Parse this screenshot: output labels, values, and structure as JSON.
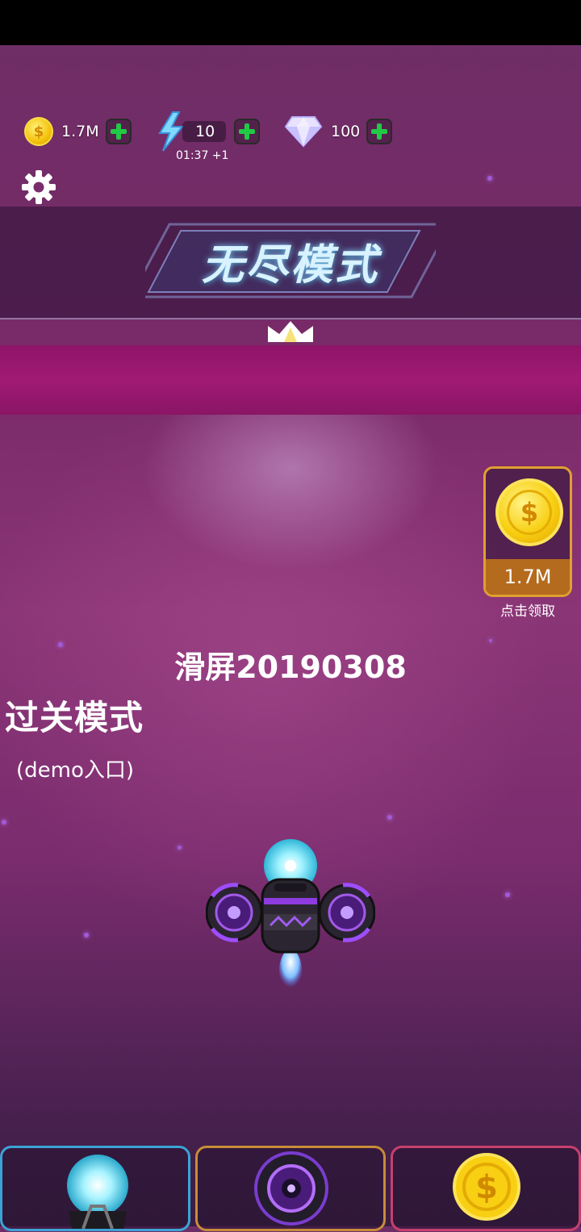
{
  "resources": {
    "coins": {
      "value": "1.7M",
      "icon": "coin-icon"
    },
    "energy": {
      "value": "10",
      "timer": "01:37 +1",
      "icon": "lightning-icon"
    },
    "gems": {
      "value": "100",
      "icon": "diamond-icon"
    }
  },
  "banner": {
    "title": "无尽模式"
  },
  "reward": {
    "amount": "1.7M",
    "label": "点击领取"
  },
  "main": {
    "swipe_label": "滑屏20190308",
    "level_mode": "过关模式",
    "demo_entry": "(demo入口)"
  },
  "tabs": [
    {
      "name": "orb-weapon",
      "icon": "orb-icon"
    },
    {
      "name": "vortex-wing",
      "icon": "vortex-icon"
    },
    {
      "name": "coin-shop",
      "icon": "coin-icon"
    }
  ],
  "colors": {
    "accent_green": "#22c945",
    "coin_gold": "#f8cf12",
    "tab_blue": "#3ba4d6",
    "tab_orange": "#c88c3a",
    "tab_red": "#c8406e"
  }
}
